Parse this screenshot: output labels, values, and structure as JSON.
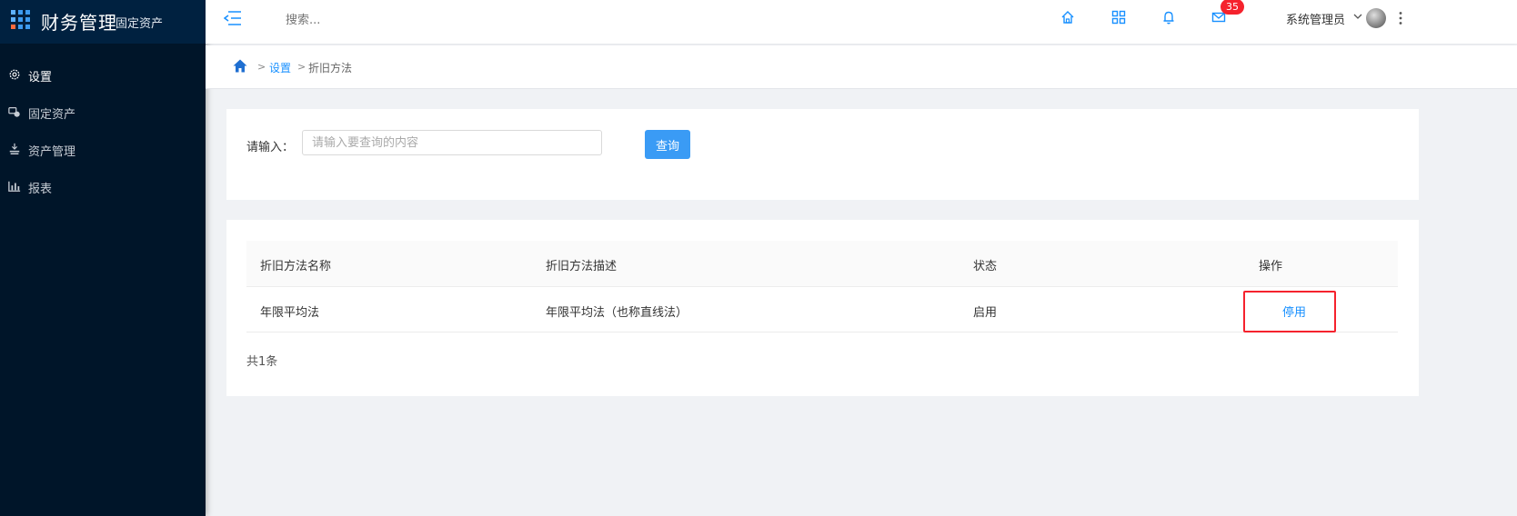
{
  "app": {
    "title": "财务管理",
    "subtitle": "固定资产"
  },
  "sidebar": {
    "items": [
      {
        "label": "设置",
        "icon": "gear-icon",
        "active": true
      },
      {
        "label": "固定资产",
        "icon": "assets-icon",
        "active": false
      },
      {
        "label": "资产管理",
        "icon": "asset-manage-icon",
        "active": false
      },
      {
        "label": "报表",
        "icon": "bar-chart-icon",
        "active": false
      }
    ]
  },
  "header": {
    "search_placeholder": "搜索...",
    "icons": [
      "home-icon",
      "apps-grid-icon",
      "bell-icon",
      "mail-icon"
    ],
    "mail_badge": "35",
    "user_name": "系统管理员"
  },
  "breadcrumb": {
    "items": [
      "设置",
      "折旧方法"
    ],
    "separator": ">"
  },
  "query": {
    "label": "请输入：",
    "placeholder": "请输入要查询的内容",
    "value": "",
    "button": "查询"
  },
  "table": {
    "columns": [
      "折旧方法名称",
      "折旧方法描述",
      "状态",
      "操作"
    ],
    "rows": [
      {
        "name": "年限平均法",
        "description": "年限平均法（也称直线法）",
        "status": "启用",
        "action": "停用"
      }
    ],
    "total": "共1条"
  },
  "colors": {
    "sidebar_bg": "#001529",
    "primary": "#1890ff",
    "badge": "#f5222d",
    "highlight_box": "#f5222d"
  }
}
